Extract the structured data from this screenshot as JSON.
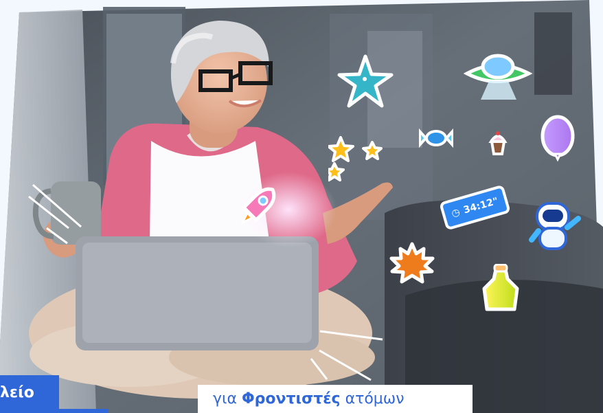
{
  "page": {
    "left_fragment": "λείο",
    "tagline": {
      "prefix": "για",
      "bold": "Φροντιστές",
      "suffix": "ατόμων"
    },
    "timer_text": "34:12\"",
    "accent_color": "#2f67d8",
    "icons": [
      "starfish-icon",
      "ufo-icon",
      "balloon-icon",
      "cupcake-icon",
      "candy-icon",
      "star-icon",
      "rocket-icon",
      "timer-badge",
      "robot-astronaut-icon",
      "maple-leaf-icon",
      "potion-bottle-icon"
    ]
  }
}
